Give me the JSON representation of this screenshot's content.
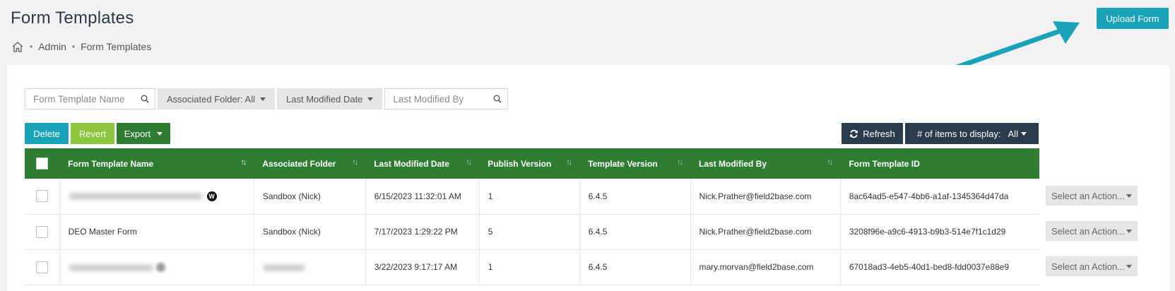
{
  "header": {
    "title": "Form Templates",
    "breadcrumb": [
      {
        "label": "Admin"
      },
      {
        "label": "Form Templates"
      }
    ],
    "upload_label": "Upload Form"
  },
  "filters": {
    "name_placeholder": "Form Template Name",
    "folder_label": "Associated Folder: All",
    "date_label": "Last Modified Date",
    "modified_by_placeholder": "Last Modified By"
  },
  "toolbar": {
    "delete_label": "Delete",
    "revert_label": "Revert",
    "export_label": "Export",
    "refresh_label": "Refresh",
    "items_label": "# of items to display:",
    "items_value": "All"
  },
  "table": {
    "columns": [
      "Form Template Name",
      "Associated Folder",
      "Last Modified Date",
      "Publish Version",
      "Template Version",
      "Last Modified By",
      "Form Template ID"
    ],
    "rows": [
      {
        "name": "",
        "folder": "Sandbox (Nick)",
        "date": "6/15/2023 11:32:01 AM",
        "publish": "1",
        "template": "6.4.5",
        "modified_by": "Nick.Prather@field2base.com",
        "id": "8ac64ad5-e547-4bb6-a1af-1345364d47da",
        "action": "Select an Action..."
      },
      {
        "name": "DEO Master Form",
        "folder": "Sandbox (Nick)",
        "date": "7/17/2023 1:29:22 PM",
        "publish": "5",
        "template": "6.4.5",
        "modified_by": "Nick.Prather@field2base.com",
        "id": "3208f96e-a9c6-4913-b9b3-514e7f1c1d29",
        "action": "Select an Action..."
      },
      {
        "name": "",
        "folder": "",
        "date": "3/22/2023 9:17:17 AM",
        "publish": "1",
        "template": "6.4.5",
        "modified_by": "mary.morvan@field2base.com",
        "id": "67018ad3-4eb5-40d1-bed8-fdd0037e88e9",
        "action": "Select an Action..."
      }
    ]
  },
  "colors": {
    "teal": "#1aa3b8",
    "green_header": "#2e7d32",
    "lime": "#8cc63f",
    "navy": "#2b3b4e"
  }
}
